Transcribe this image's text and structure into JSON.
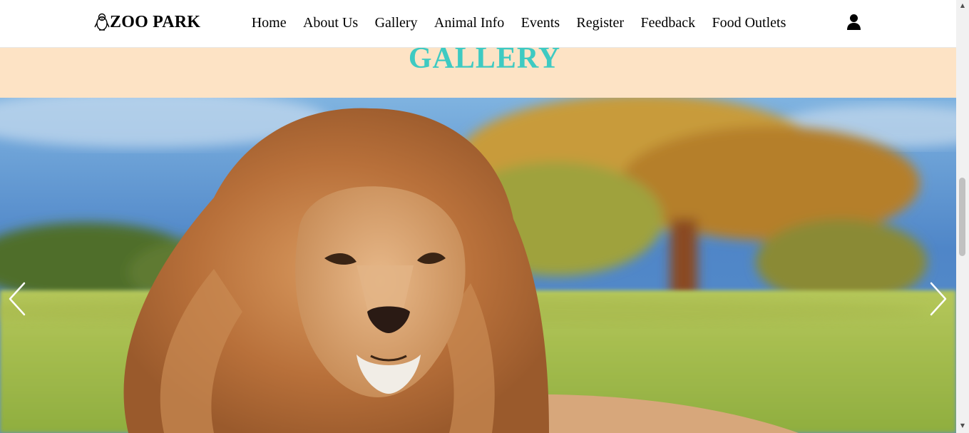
{
  "navbar": {
    "brand": "ZOO PARK",
    "brand_icon": "penguin-icon",
    "links": [
      {
        "label": "Home"
      },
      {
        "label": "About Us"
      },
      {
        "label": "Gallery"
      },
      {
        "label": "Animal Info"
      },
      {
        "label": "Events"
      },
      {
        "label": "Register"
      },
      {
        "label": "Feedback"
      },
      {
        "label": "Food Outlets"
      }
    ],
    "user_icon": "user-icon"
  },
  "header": {
    "title": "GALLERY"
  },
  "carousel": {
    "slide_image": "lion-photo",
    "prev_icon": "chevron-left-icon",
    "next_icon": "chevron-right-icon"
  },
  "colors": {
    "header_bg": "#fde3c5",
    "title_color": "#3ecac2",
    "nav_bg": "#ffffff"
  }
}
